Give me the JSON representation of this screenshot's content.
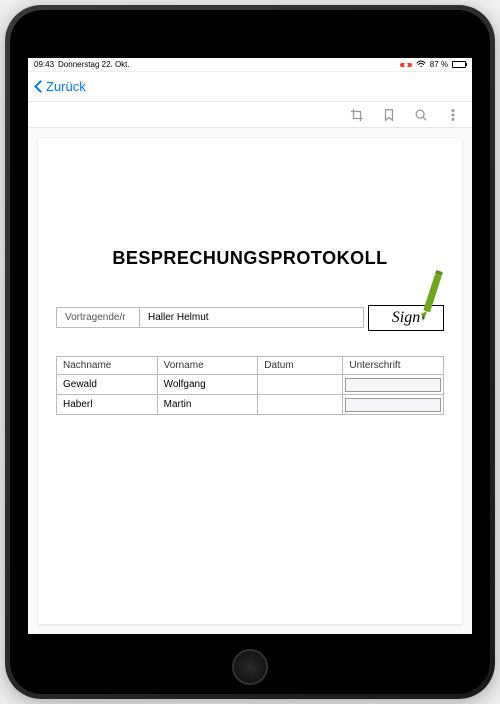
{
  "status": {
    "time": "09:43",
    "date": "Donnerstag 22. Okt.",
    "battery_pct": "87 %"
  },
  "nav": {
    "back_label": "Zurück"
  },
  "document": {
    "title": "BESPRECHUNGSPROTOKOLL",
    "presenter_label": "Vortragende/r",
    "presenter_name": "Haller Helmut",
    "sign_button_label": "Sign"
  },
  "table": {
    "headers": {
      "lastname": "Nachname",
      "firstname": "Vorname",
      "date": "Datum",
      "signature": "Unterschrift"
    },
    "rows": [
      {
        "lastname": "Gewald",
        "firstname": "Wolfgang",
        "date": "",
        "signature": ""
      },
      {
        "lastname": "Haberl",
        "firstname": "Martin",
        "date": "",
        "signature": ""
      }
    ]
  }
}
